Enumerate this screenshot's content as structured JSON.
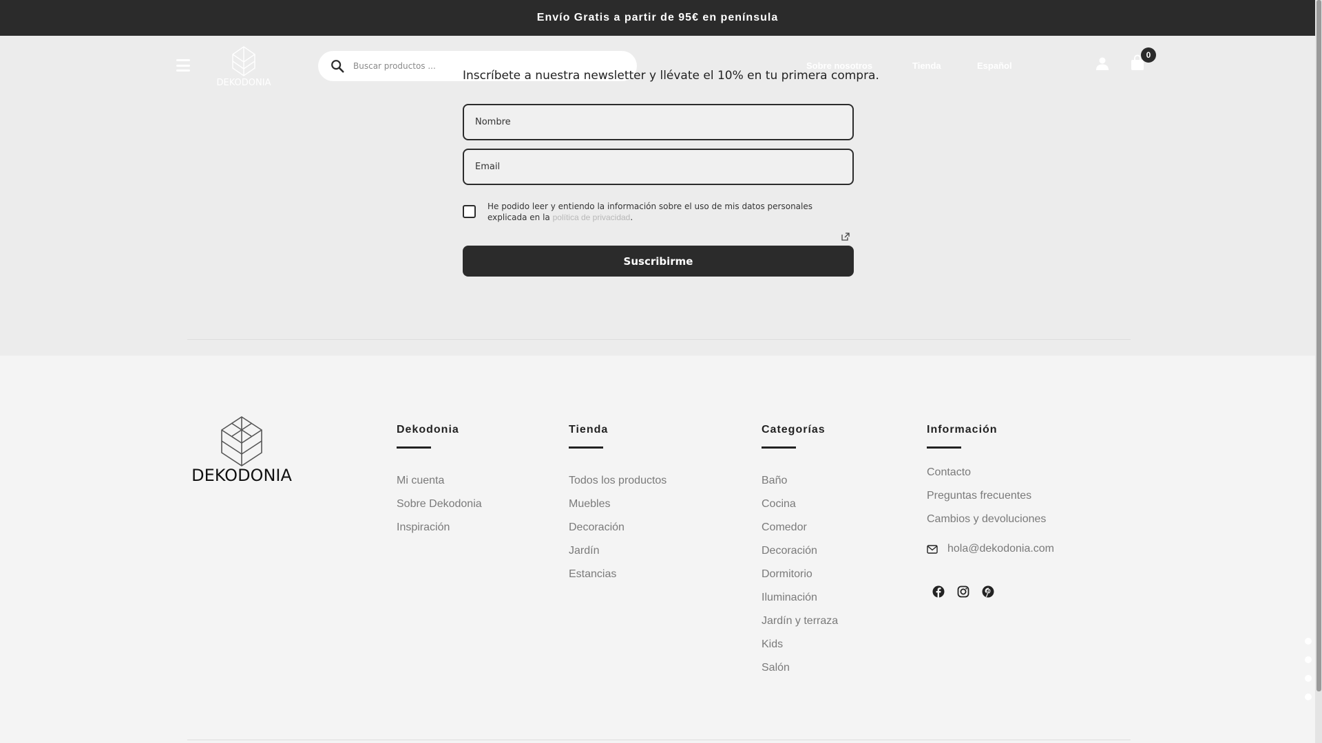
{
  "topbar": {
    "text": "Envío Gratis a partir de 95€ en península"
  },
  "header": {
    "logo_text": "DEKODONIA",
    "search_placeholder": "Buscar productos ...",
    "nav": [
      "Sobre nosotros",
      "Tienda",
      "Español"
    ],
    "cart_count": "0"
  },
  "newsletter": {
    "text": "Inscríbete a nuestra newsletter y llévate el 10% en tu primera compra.",
    "name_placeholder": "Nombre",
    "email_placeholder": "Email",
    "consent_text": "He podido leer y entiendo la información sobre el uso de mis datos personales explicada en la",
    "consent_link": "política de privacidad",
    "consent_end": ".",
    "button": "Suscribirme"
  },
  "footer": {
    "logo_text": "DEKODONIA",
    "columns": [
      {
        "title": "Dekodonia",
        "links": [
          "Mi cuenta",
          "Sobre Dekodonia",
          "Inspiración"
        ]
      },
      {
        "title": "Tienda",
        "links": [
          "Todos los productos",
          "Muebles",
          "Decoración",
          "Jardín",
          "Estancias"
        ]
      },
      {
        "title": "Categorías",
        "links": [
          "Baño",
          "Cocina",
          "Comedor",
          "Decoración",
          "Dormitorio",
          "Iluminación",
          "Jardín y terraza",
          "Kids",
          "Salón"
        ]
      },
      {
        "title": "Información",
        "links": [
          "Contacto",
          "Preguntas frecuentes",
          "Cambios y devoluciones"
        ]
      }
    ],
    "email": "hola@dekodonia.com",
    "social": [
      "facebook-icon",
      "instagram-icon",
      "pinterest-icon"
    ]
  }
}
